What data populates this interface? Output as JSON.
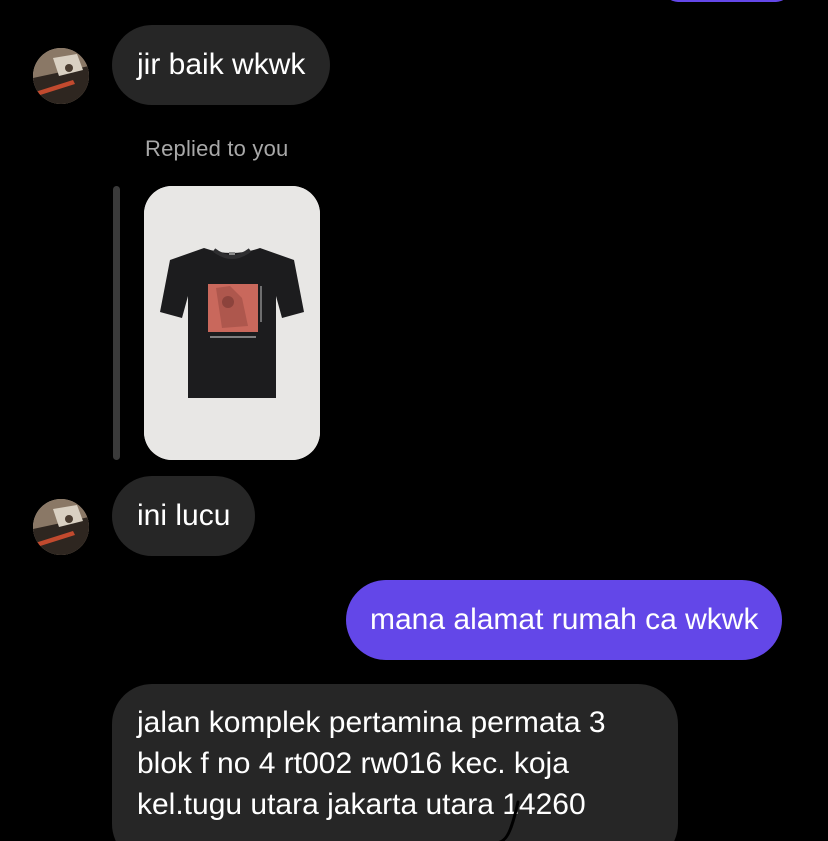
{
  "colors": {
    "background": "#000000",
    "incoming_bubble": "#262626",
    "outgoing_bubble": "#6347e8",
    "muted_text": "#a8a8a8"
  },
  "messages": [
    {
      "direction": "incoming",
      "text": "jir baik wkwk",
      "avatar": "contact-avatar"
    },
    {
      "direction": "incoming",
      "type": "story-reply",
      "reply_label": "Replied to you",
      "image": "black-tshirt-product-photo"
    },
    {
      "direction": "incoming",
      "text": "ini lucu",
      "avatar": "contact-avatar"
    },
    {
      "direction": "outgoing",
      "text": "mana alamat rumah ca wkwk"
    },
    {
      "direction": "incoming",
      "lines": [
        "jalan komplek pertamina permata 3",
        "blok f no 4 rt002 rw016 kec. koja",
        "kel.tugu utara jakarta utara 14260"
      ]
    }
  ]
}
